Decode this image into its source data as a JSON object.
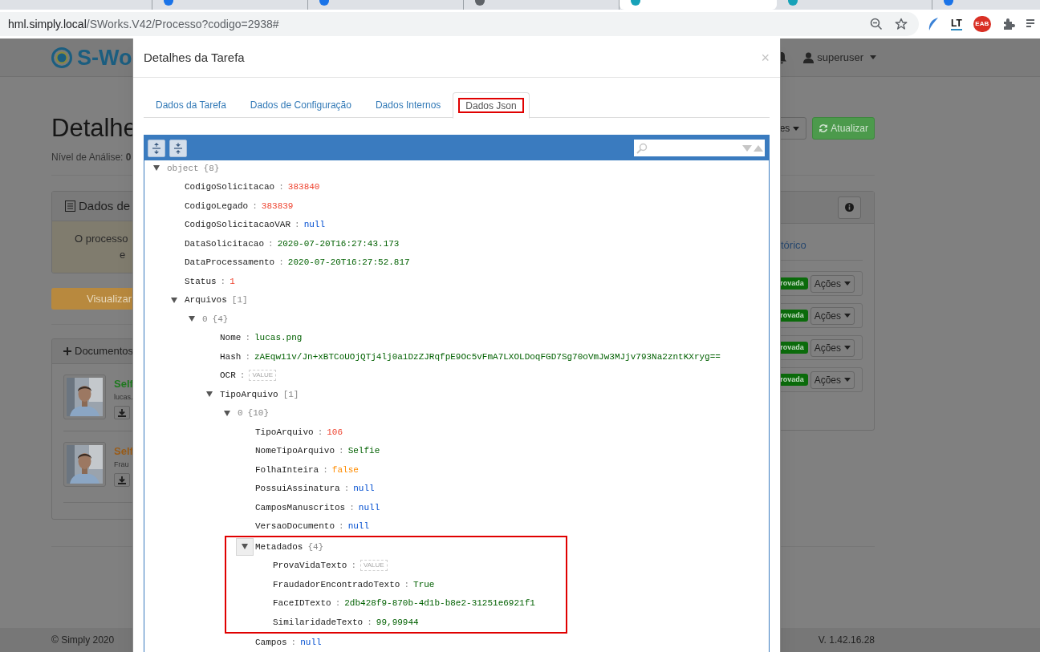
{
  "browser": {
    "tabs": [
      {
        "selected": false
      },
      {
        "selected": false,
        "color": "#1a73e8"
      },
      {
        "selected": false,
        "color": "#1a73e8"
      },
      {
        "selected": false,
        "color": "#5f6368"
      },
      {
        "selected": true,
        "color": "#17a2b8"
      },
      {
        "selected": false,
        "color": "#17a2b8"
      },
      {
        "selected": false,
        "color": "#1a73e8"
      }
    ],
    "url": {
      "host": "hml.simply.local",
      "path": "/SWorks.V42/Processo?codigo=2938#"
    },
    "address_icons": [
      {
        "kind": "zoom"
      },
      {
        "kind": "star"
      }
    ],
    "extensions": [
      {
        "kind": "feather"
      },
      {
        "kind": "text",
        "label": "LT"
      },
      {
        "kind": "stop",
        "label": "EAB"
      },
      {
        "kind": "puzzle"
      },
      {
        "kind": "queue"
      }
    ]
  },
  "page": {
    "logo": "S-Wo",
    "user": "superuser",
    "title": "Detalhe",
    "subtitle": "Nível de Análise: **0**",
    "actions_dropdown": "es",
    "refresh_button": "Atualizar",
    "data_panel": {
      "title": "Dados de",
      "message": [
        "O processo",
        "e"
      ]
    },
    "view_button": "Visualizar",
    "documents": {
      "title": "Documentos",
      "items": [
        {
          "title": "Self",
          "subtitle": "lucas.",
          "color": "#1e7a1e"
        },
        {
          "title": "Self",
          "subtitle": "Frau",
          "color": "#9a5c18"
        }
      ]
    },
    "history_link": "tórico",
    "status_rows": [
      {
        "badge": "rovada",
        "button": "Ações"
      },
      {
        "badge": "rovada",
        "button": "Ações"
      },
      {
        "badge": "rovada",
        "button": "Ações"
      },
      {
        "badge": "rovada",
        "button": "Ações"
      }
    ],
    "footer_left": "© Simply 2020",
    "footer_right": "V. 1.42.16.28"
  },
  "modal": {
    "title": "Detalhes da Tarefa",
    "close": "×",
    "tabs": [
      {
        "label": "Dados da Tarefa",
        "selected": false,
        "highlighted": false
      },
      {
        "label": "Dados de Configuração",
        "selected": false,
        "highlighted": false
      },
      {
        "label": "Dados Internos",
        "selected": false,
        "highlighted": false
      },
      {
        "label": "Dados Json",
        "selected": true,
        "highlighted": true
      }
    ],
    "editor": {
      "separator": ":",
      "tree": {
        "key": "object",
        "kind": "index",
        "count": "{8}",
        "expanded": true,
        "children": [
          {
            "key": "CodigoSolicitacao",
            "kind": "number",
            "value": "383840"
          },
          {
            "key": "CodigoLegado",
            "kind": "number",
            "value": "383839"
          },
          {
            "key": "CodigoSolicitacaoVAR",
            "kind": "null",
            "value": "null"
          },
          {
            "key": "DataSolicitacao",
            "kind": "string",
            "value": "2020-07-20T16:27:43.173"
          },
          {
            "key": "DataProcessamento",
            "kind": "string",
            "value": "2020-07-20T16:27:52.817"
          },
          {
            "key": "Status",
            "kind": "number",
            "value": "1"
          },
          {
            "key": "Arquivos",
            "kind": "field",
            "count": "[1]",
            "expanded": true,
            "children": [
              {
                "key": "0",
                "kind": "index",
                "count": "{4}",
                "expanded": true,
                "children": [
                  {
                    "key": "Nome",
                    "kind": "string",
                    "value": "lucas.png"
                  },
                  {
                    "key": "Hash",
                    "kind": "string",
                    "value": "zAEqw11v/Jn+xBTCoUOjQTj4lj0a1DzZJRqfpE9Oc5vFmA7LXOLDoqFGD7Sg70oVmJw3MJjv793Na2zntKXryg=="
                  },
                  {
                    "key": "OCR",
                    "kind": "empty",
                    "placeholder": "VALUE"
                  },
                  {
                    "key": "TipoArquivo",
                    "kind": "field",
                    "count": "[1]",
                    "expanded": true,
                    "children": [
                      {
                        "key": "0",
                        "kind": "index",
                        "count": "{10}",
                        "expanded": true,
                        "children": [
                          {
                            "key": "TipoArquivo",
                            "kind": "number",
                            "value": "106"
                          },
                          {
                            "key": "NomeTipoArquivo",
                            "kind": "string",
                            "value": "Selfie"
                          },
                          {
                            "key": "FolhaInteira",
                            "kind": "boolean",
                            "value": "false"
                          },
                          {
                            "key": "PossuiAssinatura",
                            "kind": "null",
                            "value": "null"
                          },
                          {
                            "key": "CamposManuscritos",
                            "kind": "null",
                            "value": "null"
                          },
                          {
                            "key": "VersaoDocumento",
                            "kind": "null",
                            "value": "null"
                          },
                          {
                            "key": "Metadados",
                            "kind": "field",
                            "count": "{4}",
                            "expanded": true,
                            "highlighted": true,
                            "hovered": true,
                            "children": [
                              {
                                "key": "ProvaVidaTexto",
                                "kind": "empty",
                                "placeholder": "VALUE"
                              },
                              {
                                "key": "FraudadorEncontradoTexto",
                                "kind": "string",
                                "value": "True"
                              },
                              {
                                "key": "FaceIDTexto",
                                "kind": "string",
                                "value": "2db428f9-870b-4d1b-b8e2-31251e6921f1"
                              },
                              {
                                "key": "SimilaridadeTexto",
                                "kind": "string",
                                "value": "99,99944"
                              }
                            ]
                          },
                          {
                            "key": "Campos",
                            "kind": "null",
                            "value": "null"
                          }
                        ]
                      }
                    ]
                  }
                ]
              }
            ]
          }
        ]
      }
    }
  }
}
